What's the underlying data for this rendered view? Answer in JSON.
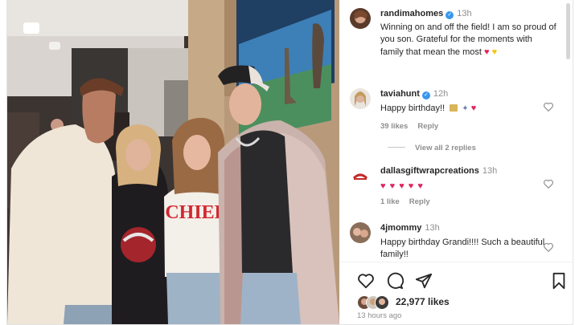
{
  "post": {
    "caption": {
      "username": "randimahomes",
      "verified": true,
      "time": "13h",
      "text": "Winning on and off the field! I am so proud of you son. Grateful for the moments with family that mean the most",
      "emojis": [
        "red-heart",
        "yellow-heart"
      ]
    },
    "photo": {
      "sweater_text": "CHIEFS"
    }
  },
  "comments": [
    {
      "username": "taviahunt",
      "verified": true,
      "time": "12h",
      "text": "Happy birthday!!",
      "emojis": [
        "wrapped-gift",
        "party-popper",
        "red-heart"
      ],
      "likes": "39 likes",
      "reply": "Reply",
      "view_replies": "View all 2 replies"
    },
    {
      "username": "dallasgiftwrapcreations",
      "verified": false,
      "time": "13h",
      "text": "",
      "emojis": [
        "red-heart",
        "red-heart",
        "red-heart",
        "red-heart",
        "red-heart"
      ],
      "likes": "1 like",
      "reply": "Reply"
    },
    {
      "username": "4jmommy",
      "verified": false,
      "time": "13h",
      "text": "Happy birthday Grandi!!!! Such a beautiful family!!"
    }
  ],
  "footer": {
    "likes": "22,977 likes",
    "time_ago": "13 hours ago"
  },
  "icons": [
    "heart-icon",
    "comment-icon",
    "share-icon",
    "bookmark-icon",
    "verified-icon"
  ],
  "colors": {
    "verified": "#3897f0",
    "heart": "#e0245e",
    "chiefs_red": "#d32630"
  }
}
